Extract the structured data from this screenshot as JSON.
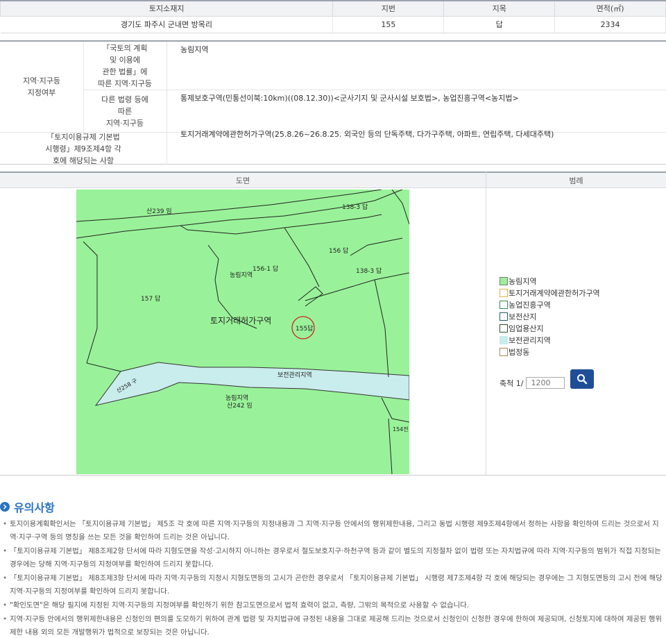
{
  "land_table": {
    "headers": [
      "토지소재지",
      "지번",
      "지목",
      "면적(㎡)"
    ],
    "row": [
      "경기도 파주시 군내면 방목리",
      "155",
      "답",
      "2334"
    ]
  },
  "zone": {
    "group_label": "지역·지구등\n지정여부",
    "row1_label": "「국토의 계획\n및 이용에\n관한 법률」에\n따른 지역·지구등",
    "row1_value": "농림지역",
    "row2_label": "다른 법령 등에\n따른\n지역·지구등",
    "row2_value": "통제보호구역(민통선이북:10km)((08.12.30))<군사기지 및 군사시설 보호법>, 농업진흥구역<농지법>",
    "row3_label": "「토지이용규제 기본법\n시행령」제9조제4항 각\n호에 해당되는 사항",
    "row3_value": "토지거래계약에관한허가구역(25.8.26~26.8.25. 외국인 등의 단독주택, 다가구주택, 아파트, 연립주택, 다세대주택)"
  },
  "map": {
    "header": "도면",
    "labels": {
      "san239": "산239 임",
      "l1383a": "138-3 답",
      "l156": "156 답",
      "l1561": "156-1 답",
      "l1383b": "138-3 답",
      "nongrim1": "농림지역",
      "l157": "157 답",
      "permit": "토지거래허가구역",
      "l155": "155답",
      "bojeon": "보전관리지역",
      "san258": "산258 구",
      "nongrim2": "농림지역",
      "san242": "산242 임",
      "l154": "154전"
    }
  },
  "legend": {
    "header": "범례",
    "items": [
      {
        "label": "농림지역",
        "color": "#99f299",
        "border": "#7a7a7a"
      },
      {
        "label": "토지거래계약에관한허가구역",
        "color": "#ffffff",
        "border": "#e0b24a"
      },
      {
        "label": "농업진흥구역",
        "color": "#ffffff",
        "border": "#2e8b57"
      },
      {
        "label": "보전산지",
        "color": "#ffffff",
        "border": "#1f5f5f"
      },
      {
        "label": "임업용산지",
        "color": "#ffffff",
        "border": "#2f4f2f"
      },
      {
        "label": "보전관리지역",
        "color": "#c9ecec",
        "border": "#c9ecec"
      },
      {
        "label": "법정동",
        "color": "#ffffff",
        "border": "#a58a5a"
      }
    ]
  },
  "scale": {
    "label": "축척 1/",
    "placeholder": "1200"
  },
  "notes": {
    "title": "유의사항",
    "items": [
      "토지이용계획확인서는 「토지이용규제 기본법」 제5조 각 호에 따른 지역·지구등의 지정내용과 그 지역·지구등 안에서의 행위제한내용, 그리고 동법 시행령 제9조제4항에서 정하는 사항을 확인하여 드리는 것으로서 지역·지구·구역 등의 명칭을 쓰는 모든 것을 확인하여 드리는 것은 아닙니다.",
      "「토지이용규제 기본법」 제8조제2항 단서에 따라 지형도면을 작성·고시하지 아니하는 경우로서 철도보호지구·하천구역 등과 같이 별도의 지정절차 없이 법령 또는 자치법규에 따라 지역·지구등의 범위가 직접 지정되는 경우에는 당해 지역·지구등의 지정여부를 확인하여 드리지 못합니다.",
      "「토지이용규제 기본법」 제8조제3항 단서에 따라 지역·지구등의 지정시 지형도면등의 고시가 곤란한 경우로서 「토지이용규제 기본법」 시행령 제7조제4항 각 호에 해당되는 경우에는 그 지형도면등의 고시 전에 해당 지역·지구등의 지정여부를 확인하여 드리지 못합니다.",
      "\"확인도면\"은 해당 필지에 지정된 지역·지구등의 지정여부를 확인하기 위한 참고도면으로서 법적 효력이 없고, 측량, 그밖의 목적으로 사용할 수 없습니다.",
      "지역·지구등 안에서의 행위제한내용은 신청인의 편의를 도모하기 위하여 관계 법령 및 자치법규에 규정된 내용을 그대로 제공해 드리는 것으로서 신청인이 신청한 경우에 한하여 제공되며, 신청토지에 대하여 제공된 행위제한 내용 외의 모든 개발행위가 법적으로 보장되는 것은 아닙니다."
    ]
  }
}
